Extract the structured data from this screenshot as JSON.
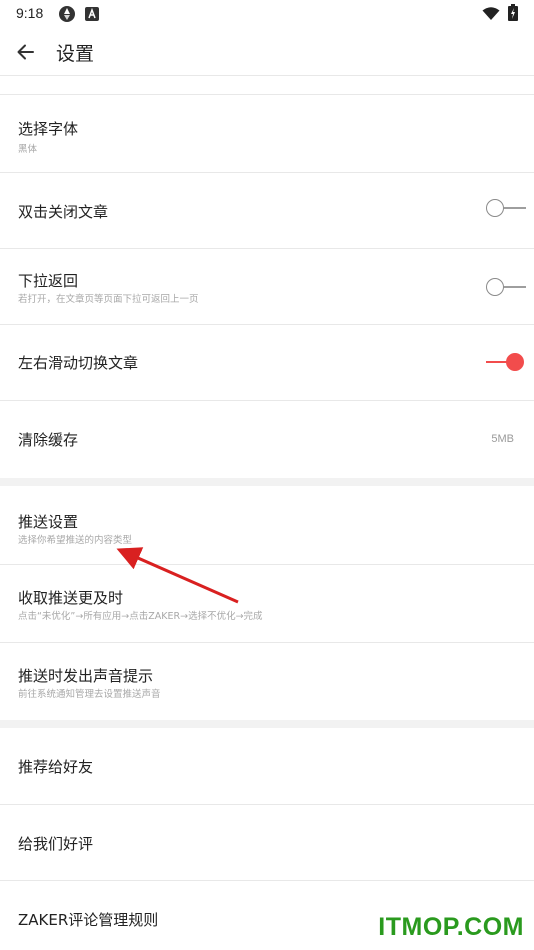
{
  "status_bar": {
    "time": "9:18",
    "icons": [
      "shutter-icon",
      "a-app-icon",
      "wifi-icon",
      "battery-charging-icon"
    ]
  },
  "app_bar": {
    "back_icon": "arrow-left-icon",
    "title": "设置"
  },
  "settings": {
    "font": {
      "title": "选择字体",
      "subtitle": "黑体"
    },
    "double_tap_close": {
      "title": "双击关闭文章",
      "toggle_on": false
    },
    "pull_back": {
      "title": "下拉返回",
      "subtitle": "若打开，在文章页等页面下拉可返回上一页",
      "toggle_on": false
    },
    "swipe_switch": {
      "title": "左右滑动切换文章",
      "toggle_on": true
    },
    "clear_cache": {
      "title": "清除缓存",
      "value": "5MB"
    },
    "push_settings": {
      "title": "推送设置",
      "subtitle": "选择你希望推送的内容类型"
    },
    "timely_push": {
      "title": "收取推送更及时",
      "subtitle": "点击“未优化”→所有应用→点击ZAKER→选择不优化→完成"
    },
    "push_sound": {
      "title": "推送时发出声音提示",
      "subtitle": "前往系统通知管理去设置推送声音"
    },
    "recommend": {
      "title": "推荐给好友"
    },
    "rate_us": {
      "title": "给我们好评"
    },
    "comment_rules": {
      "title": "ZAKER评论管理规则"
    }
  },
  "colors": {
    "accent": "#f24c4c",
    "annotation_arrow": "#d92020",
    "watermark": "#2a9a1e"
  },
  "watermark": "ITMOP.COM"
}
